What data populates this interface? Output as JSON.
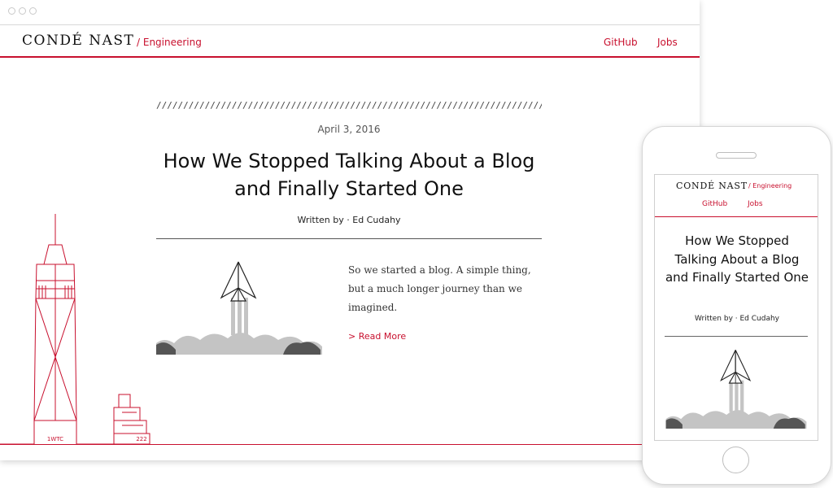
{
  "header": {
    "logo": "CONDÉ NAST",
    "logo_sub": "/ Engineering",
    "nav": [
      "GitHub",
      "Jobs"
    ]
  },
  "post": {
    "divider": "//////////////////////////////////////////////////////////////////////////////////////////////////////////////////////",
    "date": "April 3, 2016",
    "title": "How We Stopped Talking About a Blog and Finally Started One",
    "author": "Written by · Ed Cudahy",
    "excerpt": "So we started a blog. A simple thing, but a much longer journey than we imagined.",
    "read_more": "> Read More"
  },
  "skyline": {
    "labels": [
      "1WTC",
      "222"
    ]
  },
  "mobile": {
    "logo": "CONDÉ NAST",
    "logo_sub": "/ Engineering",
    "nav": [
      "GitHub",
      "Jobs"
    ],
    "title": "How We Stopped Talking About a Blog and Finally Started One",
    "author": "Written by · Ed Cudahy"
  },
  "colors": {
    "accent": "#c8102e",
    "cloud_dark": "#555555",
    "cloud_light": "#bdbdbd"
  },
  "icons": [
    "paper-plane-rocket-icon",
    "one-world-trade-center-illustration",
    "building-222-illustration"
  ]
}
